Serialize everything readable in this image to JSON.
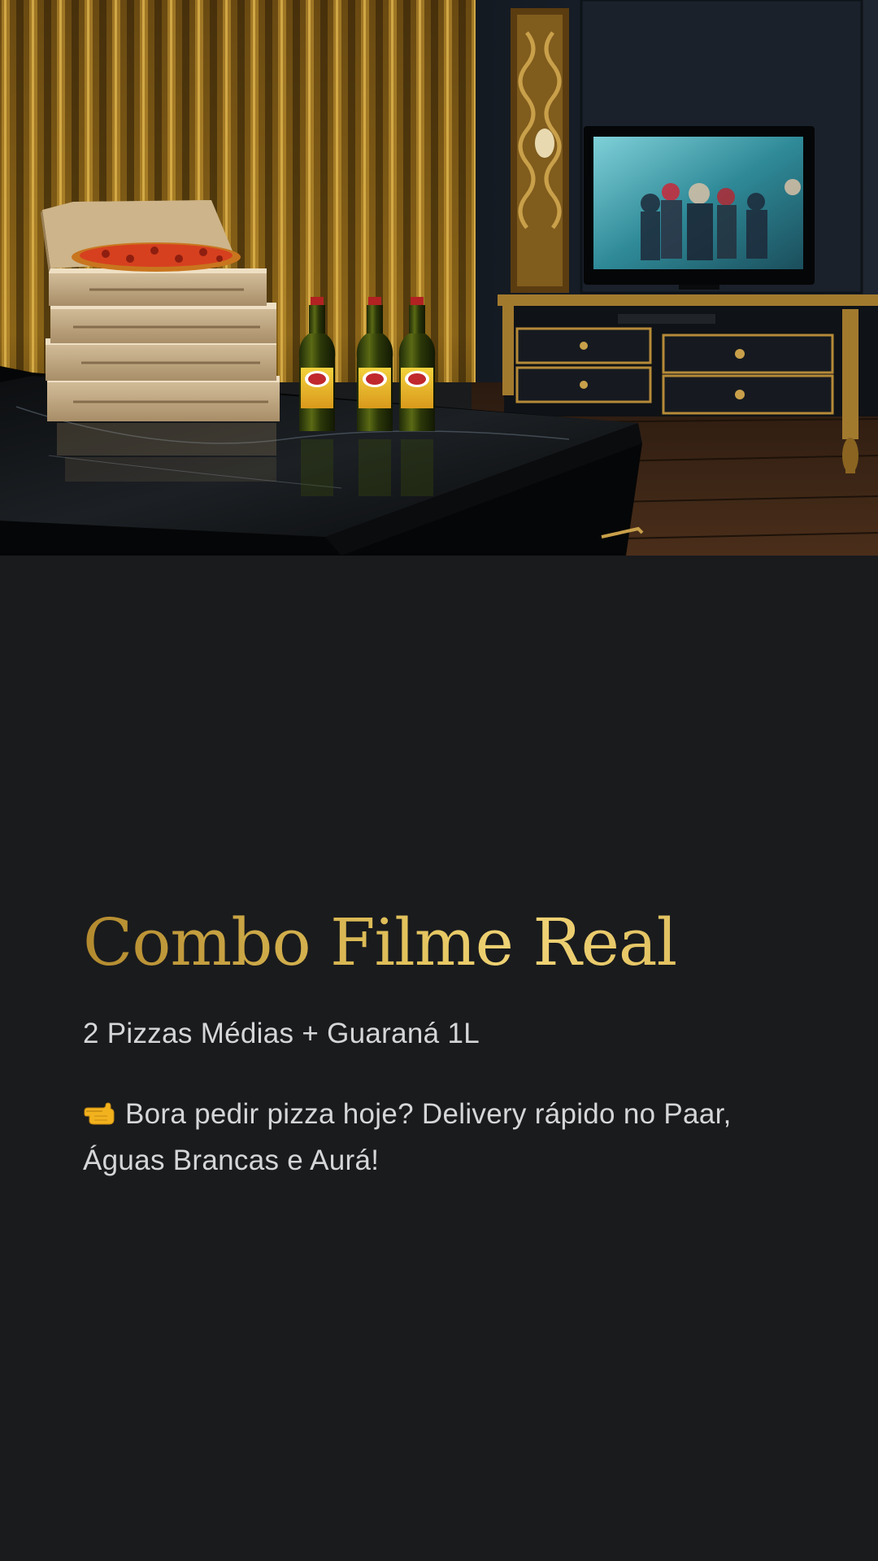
{
  "hero": {
    "icon": "movie-night-pizza-hero-image"
  },
  "combo": {
    "title": "Combo Filme Real",
    "subtitle": "2 Pizzas Médias + Guaraná 1L",
    "description_icon": "pointing-hand-icon",
    "description": "Bora pedir pizza hoje? Delivery rápido no Paar, Águas Brancas e Aurá!"
  },
  "colors": {
    "background": "#1a1b1d",
    "title_gold": "#e3c35d",
    "text": "#d5d6d8"
  }
}
